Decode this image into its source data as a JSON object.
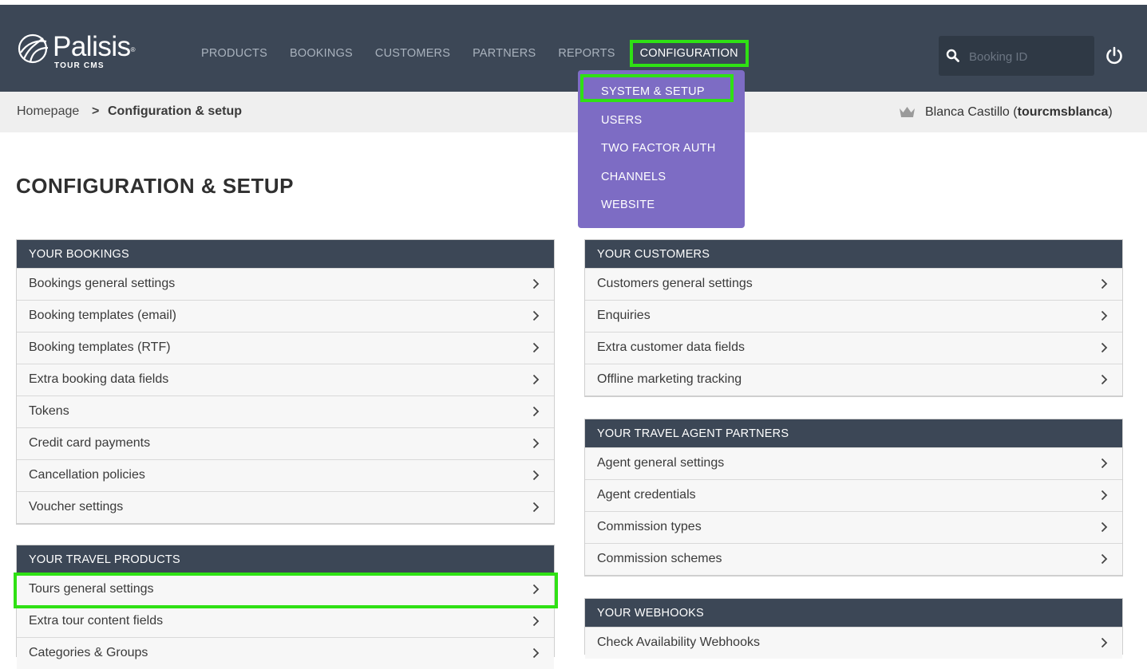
{
  "brand": {
    "name": "Palisis",
    "sub": "TOUR CMS",
    "tm": "®"
  },
  "nav": {
    "items": [
      {
        "label": "PRODUCTS"
      },
      {
        "label": "BOOKINGS"
      },
      {
        "label": "CUSTOMERS"
      },
      {
        "label": "PARTNERS"
      },
      {
        "label": "REPORTS"
      },
      {
        "label": "CONFIGURATION"
      }
    ],
    "active": "CONFIGURATION"
  },
  "search": {
    "placeholder": "Booking ID",
    "value": ""
  },
  "icons": {
    "search": "search-icon",
    "power": "power-icon",
    "crown": "crown-icon",
    "chevron": "chevron-right-icon"
  },
  "dropdown": {
    "items": [
      {
        "label": "SYSTEM & SETUP"
      },
      {
        "label": "USERS"
      },
      {
        "label": "TWO FACTOR AUTH"
      },
      {
        "label": "CHANNELS"
      },
      {
        "label": "WEBSITE"
      }
    ]
  },
  "breadcrumb": {
    "home": "Homepage",
    "separator": ">",
    "current": "Configuration & setup"
  },
  "user": {
    "name": "Blanca Castillo",
    "open": "(",
    "username": "tourcmsblanca",
    "close": ")"
  },
  "page": {
    "title": "CONFIGURATION & SETUP"
  },
  "panels": {
    "bookings": {
      "title": "YOUR BOOKINGS",
      "items": [
        "Bookings general settings",
        "Booking templates (email)",
        "Booking templates (RTF)",
        "Extra booking data fields",
        "Tokens",
        "Credit card payments",
        "Cancellation policies",
        "Voucher settings"
      ]
    },
    "products": {
      "title": "YOUR TRAVEL PRODUCTS",
      "items": [
        "Tours general settings",
        "Extra tour content fields",
        "Categories & Groups"
      ]
    },
    "customers": {
      "title": "YOUR CUSTOMERS",
      "items": [
        "Customers general settings",
        "Enquiries",
        "Extra customer data fields",
        "Offline marketing tracking"
      ]
    },
    "partners": {
      "title": "YOUR TRAVEL AGENT PARTNERS",
      "items": [
        "Agent general settings",
        "Agent credentials",
        "Commission types",
        "Commission schemes"
      ]
    },
    "webhooks": {
      "title": "YOUR WEBHOOKS",
      "items": [
        "Check Availability Webhooks"
      ]
    }
  },
  "colors": {
    "header_bg": "#3c4756",
    "dropdown_bg": "#7d6cc4",
    "highlight": "#2fe114",
    "crumb_bg": "#efefef"
  }
}
